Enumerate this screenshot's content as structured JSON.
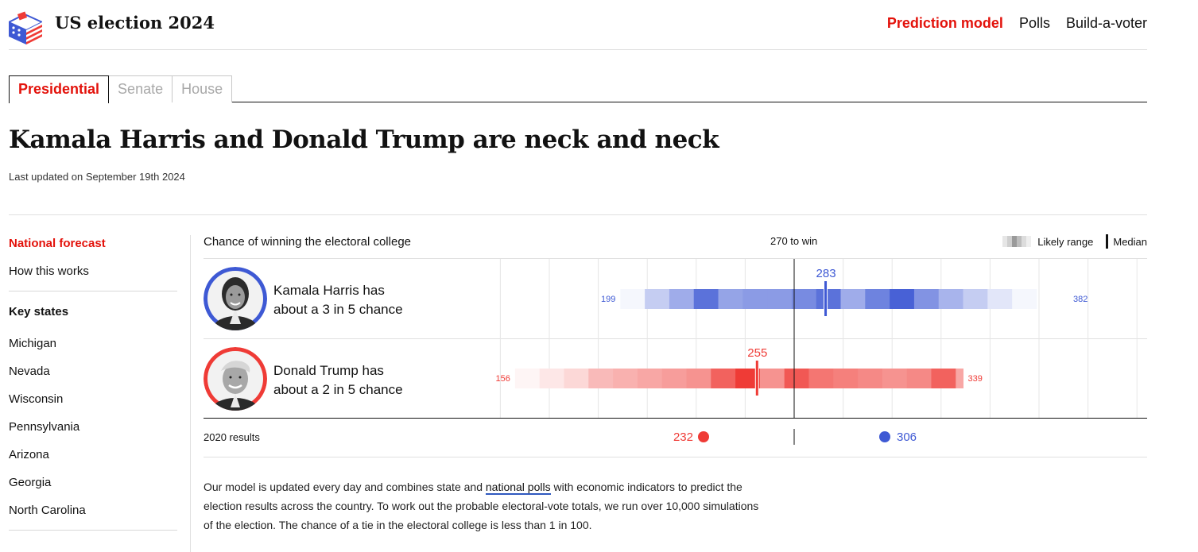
{
  "header": {
    "site_title": "US election 2024",
    "nav": [
      "Prediction model",
      "Polls",
      "Build-a-voter"
    ]
  },
  "tabs": [
    "Presidential",
    "Senate",
    "House"
  ],
  "headline": "Kamala Harris and Donald Trump are neck and neck",
  "updated": "Last updated on September 19th 2024",
  "sidebar": {
    "national_forecast": "National forecast",
    "how_this_works": "How this works",
    "key_states_heading": "Key states",
    "states": [
      "Michigan",
      "Nevada",
      "Wisconsin",
      "Pennsylvania",
      "Arizona",
      "Georgia",
      "North Carolina"
    ]
  },
  "forecast": {
    "header_label": "Chance of winning the electoral college",
    "threshold_label": "270 to win",
    "legend_range": "Likely range",
    "legend_median": "Median",
    "results_label": "2020 results"
  },
  "candidates": [
    {
      "line1": "Kamala Harris has",
      "line2": "about a 3 in 5 chance"
    },
    {
      "line1": "Donald Trump has",
      "line2": "about a 2 in 5 chance"
    }
  ],
  "colors": {
    "accent_red": "#e3120b",
    "dem_blue": "#3e59d4",
    "rep_red": "#ef3b36"
  },
  "chart_data": {
    "type": "range-strip",
    "title": "Chance of winning the electoral college",
    "threshold": 270,
    "threshold_label": "270 to win",
    "series": [
      {
        "candidate": "Kamala Harris",
        "color": "#3e59d4",
        "min": 199,
        "median": 283,
        "max": 382,
        "bins_start": 199,
        "bin_width": 10,
        "intensities": [
          0.05,
          0.3,
          0.5,
          0.85,
          0.55,
          0.6,
          0.6,
          0.7,
          0.85,
          0.5,
          0.75,
          0.95,
          0.65,
          0.45,
          0.3,
          0.15,
          0.05
        ]
      },
      {
        "candidate": "Donald Trump",
        "color": "#ef3b36",
        "min": 156,
        "median": 255,
        "max": 339,
        "bins_start": 156,
        "bin_width": 10,
        "intensities": [
          0.05,
          0.12,
          0.2,
          0.35,
          0.4,
          0.45,
          0.5,
          0.55,
          0.8,
          1.0,
          0.55,
          0.85,
          0.7,
          0.65,
          0.6,
          0.55,
          0.6,
          0.8,
          0.45,
          0.25,
          0.05
        ]
      }
    ],
    "results_2020": {
      "label": "2020 results",
      "rep": 232,
      "dem": 306
    }
  }
}
